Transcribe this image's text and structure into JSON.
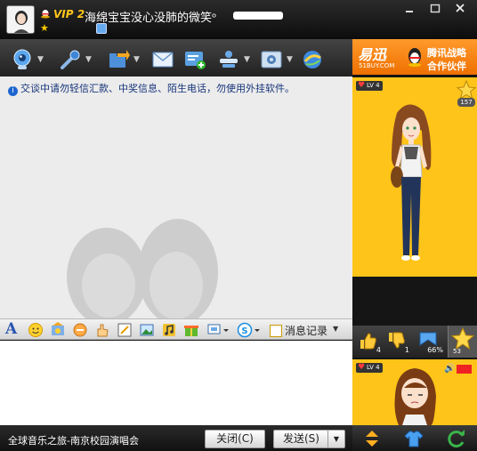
{
  "titlebar": {
    "vip_badge": "VIP 2",
    "nickname": "海绵宝宝没心没肺的微笑ᵒ",
    "window_controls": [
      "minimize",
      "maximize",
      "close"
    ]
  },
  "toolbar": {
    "items": [
      {
        "icon": "video-call-icon",
        "dropdown": true
      },
      {
        "icon": "voice-call-icon",
        "dropdown": true
      },
      {
        "icon": "send-file-icon",
        "dropdown": true
      },
      {
        "icon": "send-email-icon",
        "dropdown": false
      },
      {
        "icon": "create-group-icon",
        "dropdown": false
      },
      {
        "icon": "remote-assist-icon",
        "dropdown": true
      },
      {
        "icon": "app-settings-icon",
        "dropdown": true
      },
      {
        "icon": "browser-icon",
        "dropdown": false
      }
    ]
  },
  "chat": {
    "notice": "交谈中请勿轻信汇款、中奖信息、陌生电话，勿使用外挂软件。"
  },
  "input_toolbar": {
    "font_label": "A",
    "history_label": "消息记录",
    "icons": [
      "font-icon",
      "emoji-icon",
      "magic-expression-icon",
      "shake-window-icon",
      "rich-text-icon",
      "screenshot-icon",
      "image-icon",
      "music-icon",
      "gift-icon",
      "screen-capture-icon",
      "payment-icon"
    ]
  },
  "bottom": {
    "music_text": "全球音乐之旅-南京校园演唱会",
    "close_label": "关闭(C)",
    "send_label": "发送(S)",
    "send_dropdown": "▼"
  },
  "right_panel": {
    "ad": {
      "logo": "易迅",
      "logo_sub": "51BUY.COM",
      "text_line1": "腾讯战略",
      "text_line2": "合作伙伴"
    },
    "show1": {
      "level": "LV 4",
      "star_count": "157"
    },
    "actions": {
      "like_count": "4",
      "dislike_count": "1",
      "percent": "66%",
      "star_count": "53"
    },
    "show2": {
      "level": "LV 4"
    }
  },
  "colors": {
    "show_bg": "#ffc419",
    "ad_bg": "#ff8a1a",
    "notice_text": "#16347a",
    "titlebar": "#111111"
  }
}
